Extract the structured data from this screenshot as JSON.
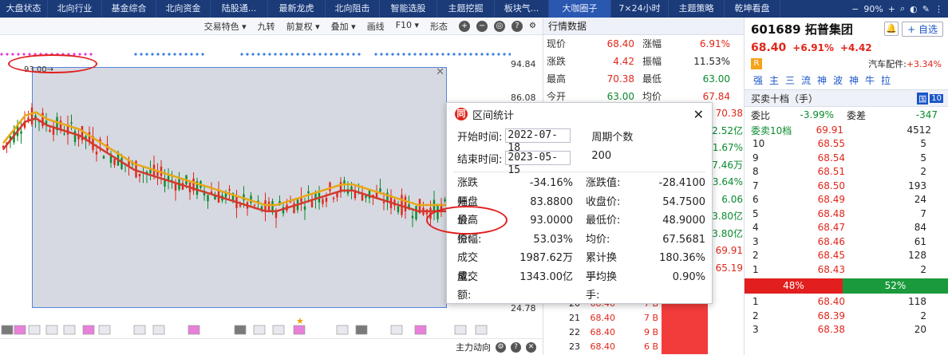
{
  "nav": {
    "tabs": [
      "大盘状态",
      "北向行业",
      "基金综合",
      "北向资金",
      "陆股通...",
      "最新龙虎",
      "北向阻击",
      "智能选股",
      "主题挖掘",
      "板块气...",
      "大咖圈子",
      "7×24小时",
      "主题策略",
      "乾坤看盘"
    ],
    "active_index": 10,
    "zoom": "90%"
  },
  "chart_toolbar": {
    "buttons": [
      "交易特色 ▾",
      "九转",
      "前复权 ▾",
      "叠加 ▾",
      "画线",
      "F10 ▾",
      "形态"
    ]
  },
  "chart": {
    "y_labels": [
      "94.84",
      "86.08",
      "24.78"
    ],
    "peak_label": "93.00→",
    "footer_label": "主力动向"
  },
  "chart_data": {
    "type": "line",
    "series_ma_a": [
      78,
      82,
      86,
      87,
      85,
      84,
      83,
      82,
      80,
      78,
      76,
      74,
      72,
      71,
      70,
      69,
      68,
      67,
      66,
      65,
      64,
      63,
      62,
      61,
      60,
      60,
      61,
      62,
      63,
      64,
      65,
      66,
      66,
      65,
      64,
      63,
      62,
      61,
      60,
      60,
      60,
      60,
      59,
      58,
      57,
      56,
      55
    ],
    "ylim": [
      24.78,
      94.84
    ]
  },
  "quote": {
    "title": "行情数据",
    "rows": [
      {
        "k1": "现价",
        "v1": "68.40",
        "c1": "red",
        "k2": "涨幅",
        "v2": "6.91%",
        "c2": "red"
      },
      {
        "k1": "涨跌",
        "v1": "4.42",
        "c1": "red",
        "k2": "振幅",
        "v2": "11.53%",
        "c2": "blk"
      },
      {
        "k1": "最高",
        "v1": "70.38",
        "c1": "red",
        "k2": "最低",
        "v2": "63.00",
        "c2": "green"
      },
      {
        "k1": "今开",
        "v1": "63.00",
        "c1": "green",
        "k2": "均价",
        "v2": "67.84",
        "c2": "red"
      }
    ],
    "partial_values": [
      "70.38",
      "2.52亿",
      "1.67%",
      "7.46万",
      "3.64%",
      "6.06",
      "3.80亿",
      "3.80亿",
      "69.91",
      "65.19"
    ],
    "trades": [
      {
        "n": "20",
        "p": "68.40",
        "v": "7 B"
      },
      {
        "n": "21",
        "p": "68.40",
        "v": "7 B"
      },
      {
        "n": "22",
        "p": "68.40",
        "v": "9 B"
      },
      {
        "n": "23",
        "p": "68.40",
        "v": "6 B"
      }
    ]
  },
  "stock": {
    "code_name": "601689 拓普集团",
    "add_label": "自选",
    "price": "68.40",
    "pct": "+6.91%",
    "chg": "+4.42",
    "industry": "汽车配件:",
    "industry_pct": "+3.34%",
    "tags": [
      "强",
      "主",
      "三",
      "流",
      "神",
      "波",
      "神",
      "牛",
      "拉"
    ],
    "orderbook_title": "买卖十档（手）",
    "weibi_label": "委比",
    "weibi_val": "-3.99%",
    "weicha_label": "委差",
    "weicha_val": "-347",
    "wm10_label": "委卖10档",
    "wm10_price": "69.91",
    "wm10_vol": "4512",
    "sell": [
      {
        "n": "10",
        "p": "68.55",
        "v": "5"
      },
      {
        "n": "9",
        "p": "68.54",
        "v": "5"
      },
      {
        "n": "8",
        "p": "68.51",
        "v": "2"
      },
      {
        "n": "7",
        "p": "68.50",
        "v": "193"
      },
      {
        "n": "6",
        "p": "68.49",
        "v": "24"
      },
      {
        "n": "5",
        "p": "68.48",
        "v": "7"
      },
      {
        "n": "4",
        "p": "68.47",
        "v": "84"
      },
      {
        "n": "3",
        "p": "68.46",
        "v": "61"
      },
      {
        "n": "2",
        "p": "68.45",
        "v": "128"
      },
      {
        "n": "1",
        "p": "68.43",
        "v": "2"
      }
    ],
    "ratio_sell": "48%",
    "ratio_buy": "52%",
    "ratio_sell_frac": 0.48,
    "buy": [
      {
        "n": "1",
        "p": "68.40",
        "v": "118"
      },
      {
        "n": "2",
        "p": "68.39",
        "v": "2"
      },
      {
        "n": "3",
        "p": "68.38",
        "v": "20"
      }
    ]
  },
  "popup": {
    "title": "区间统计",
    "start_label": "开始时间:",
    "start_value": "2022-07-18",
    "end_label": "结束时间:",
    "end_value": "2023-05-15",
    "period_label": "周期个数",
    "period_value": "200",
    "stats": [
      {
        "k1": "涨跌幅:",
        "v1": "-34.16%",
        "k2": "涨跌值:",
        "v2": "-28.4100"
      },
      {
        "k1": "开盘价:",
        "v1": "83.8800",
        "k2": "收盘价:",
        "v2": "54.7500"
      },
      {
        "k1": "最高价:",
        "v1": "93.0000",
        "k2": "最低价:",
        "v2": "48.9000"
      },
      {
        "k1": "振幅:",
        "v1": "53.03%",
        "k2": "均价:",
        "v2": "67.5681"
      },
      {
        "k1": "成交量:",
        "v1": "1987.62万",
        "k2": "累计换手:",
        "v2": "180.36%"
      },
      {
        "k1": "成交额:",
        "v1": "1343.00亿",
        "k2": "平均换手:",
        "v2": "0.90%"
      }
    ]
  }
}
